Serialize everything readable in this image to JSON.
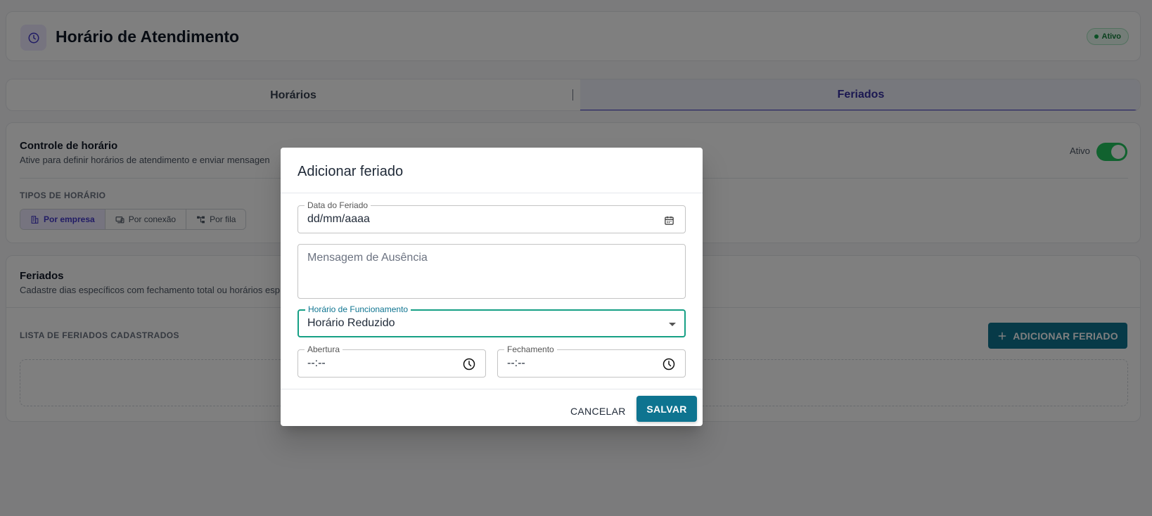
{
  "header": {
    "title": "Horário de Atendimento",
    "status_badge": "Ativo",
    "icon": "clock-icon"
  },
  "tabs": [
    {
      "label": "Horários"
    },
    {
      "label": "Feriados",
      "active": true
    }
  ],
  "control": {
    "title": "Controle de horário",
    "description": "Ative para definir horários de atendimento e enviar mensagen",
    "toggle_label": "Ativo",
    "toggle_on": true,
    "types_label": "TIPOS DE HORÁRIO",
    "types": [
      {
        "label": "Por empresa",
        "icon": "building-icon",
        "active": true
      },
      {
        "label": "Por conexão",
        "icon": "devices-icon"
      },
      {
        "label": "Por fila",
        "icon": "tree-icon"
      }
    ]
  },
  "holidays": {
    "title": "Feriados",
    "description": "Cadastre dias específicos com fechamento total ou horários esp",
    "list_label": "LISTA DE FERIADOS CADASTRADOS",
    "add_button": "ADICIONAR FERIADO"
  },
  "dialog": {
    "title": "Adicionar feriado",
    "date_field": {
      "label": "Data do Feriado",
      "value": "dd/mm/aaaa"
    },
    "message_field": {
      "placeholder": "Mensagem de Ausência"
    },
    "hours_field": {
      "label": "Horário de Funcionamento",
      "value": "Horário Reduzido"
    },
    "open_field": {
      "label": "Abertura",
      "value": "--:--"
    },
    "close_field": {
      "label": "Fechamento",
      "value": "--:--"
    },
    "cancel_label": "CANCELAR",
    "save_label": "SALVAR"
  },
  "colors": {
    "accent": "#4338ca",
    "primary": "#0e7490",
    "success": "#22c55e",
    "focus": "#16a085"
  }
}
